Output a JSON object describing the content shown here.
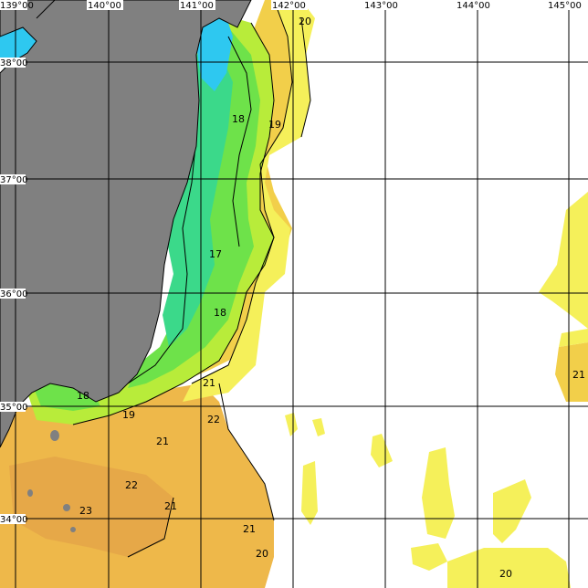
{
  "map": {
    "lon_labels": [
      "139°00",
      "140°00",
      "141°00",
      "142°00",
      "143°00",
      "144°00",
      "145°00"
    ],
    "lat_labels": [
      "38°00",
      "37°00",
      "36°00",
      "35°00",
      "34°00"
    ],
    "contour_labels": [
      "20",
      "18",
      "19",
      "17",
      "18",
      "21",
      "18",
      "19",
      "22",
      "21",
      "22",
      "21",
      "23",
      "21",
      "20",
      "21",
      "20"
    ],
    "colors": {
      "land": "#808080",
      "water_none": "#ffffff",
      "sst_17": "#3bd98a",
      "sst_18": "#6ee24a",
      "sst_19": "#b8ec3a",
      "sst_20": "#f5f05a",
      "sst_21": "#f2cf4a",
      "sst_22": "#eeb84a",
      "sst_23": "#e6a848",
      "sst_cold": "#2ec8f0",
      "grid": "#000000",
      "tick_text": "#1a2ea8"
    }
  }
}
